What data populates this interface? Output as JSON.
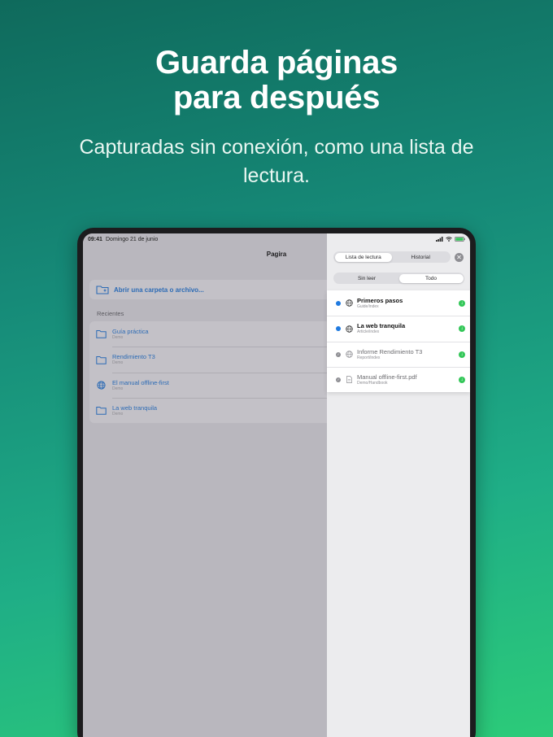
{
  "hero": {
    "title_line1": "Guarda páginas",
    "title_line2": "para después",
    "subtitle": "Capturadas sin conexión, como una lista de lectura."
  },
  "status_bar": {
    "time": "09:41",
    "date": "Domingo 21 de junio"
  },
  "main": {
    "title": "Pagira",
    "open_label": "Abrir una carpeta o archivo...",
    "recents_header": "Recientes",
    "recents": [
      {
        "name": "Guía práctica",
        "sub": "Demo",
        "icon": "folder-icon"
      },
      {
        "name": "Rendimiento T3",
        "sub": "Demo",
        "icon": "folder-icon"
      },
      {
        "name": "El manual offline-first",
        "sub": "Demo",
        "icon": "globe-icon"
      },
      {
        "name": "La web tranquila",
        "sub": "Demo",
        "icon": "folder-icon"
      }
    ]
  },
  "sheet": {
    "tabs": [
      "Lista de lectura",
      "Historial"
    ],
    "active_tab": "Lista de lectura",
    "filters": [
      "Sin leer",
      "Todo"
    ],
    "active_filter": "Todo",
    "items": [
      {
        "name": "Primeros pasos",
        "sub": "Guide/index",
        "read": false,
        "icon": "globe-icon"
      },
      {
        "name": "La web tranquila",
        "sub": "Article/index",
        "read": false,
        "icon": "globe-icon"
      },
      {
        "name": "Informe Rendimiento T3",
        "sub": "Report/index",
        "read": true,
        "icon": "globe-icon"
      },
      {
        "name": "Manual offline-first.pdf",
        "sub": "Demo/Handbook",
        "read": true,
        "icon": "document-icon"
      }
    ]
  },
  "colors": {
    "accent": "#2c6bb5",
    "unread": "#1f7ae0",
    "downloaded": "#34c759"
  }
}
